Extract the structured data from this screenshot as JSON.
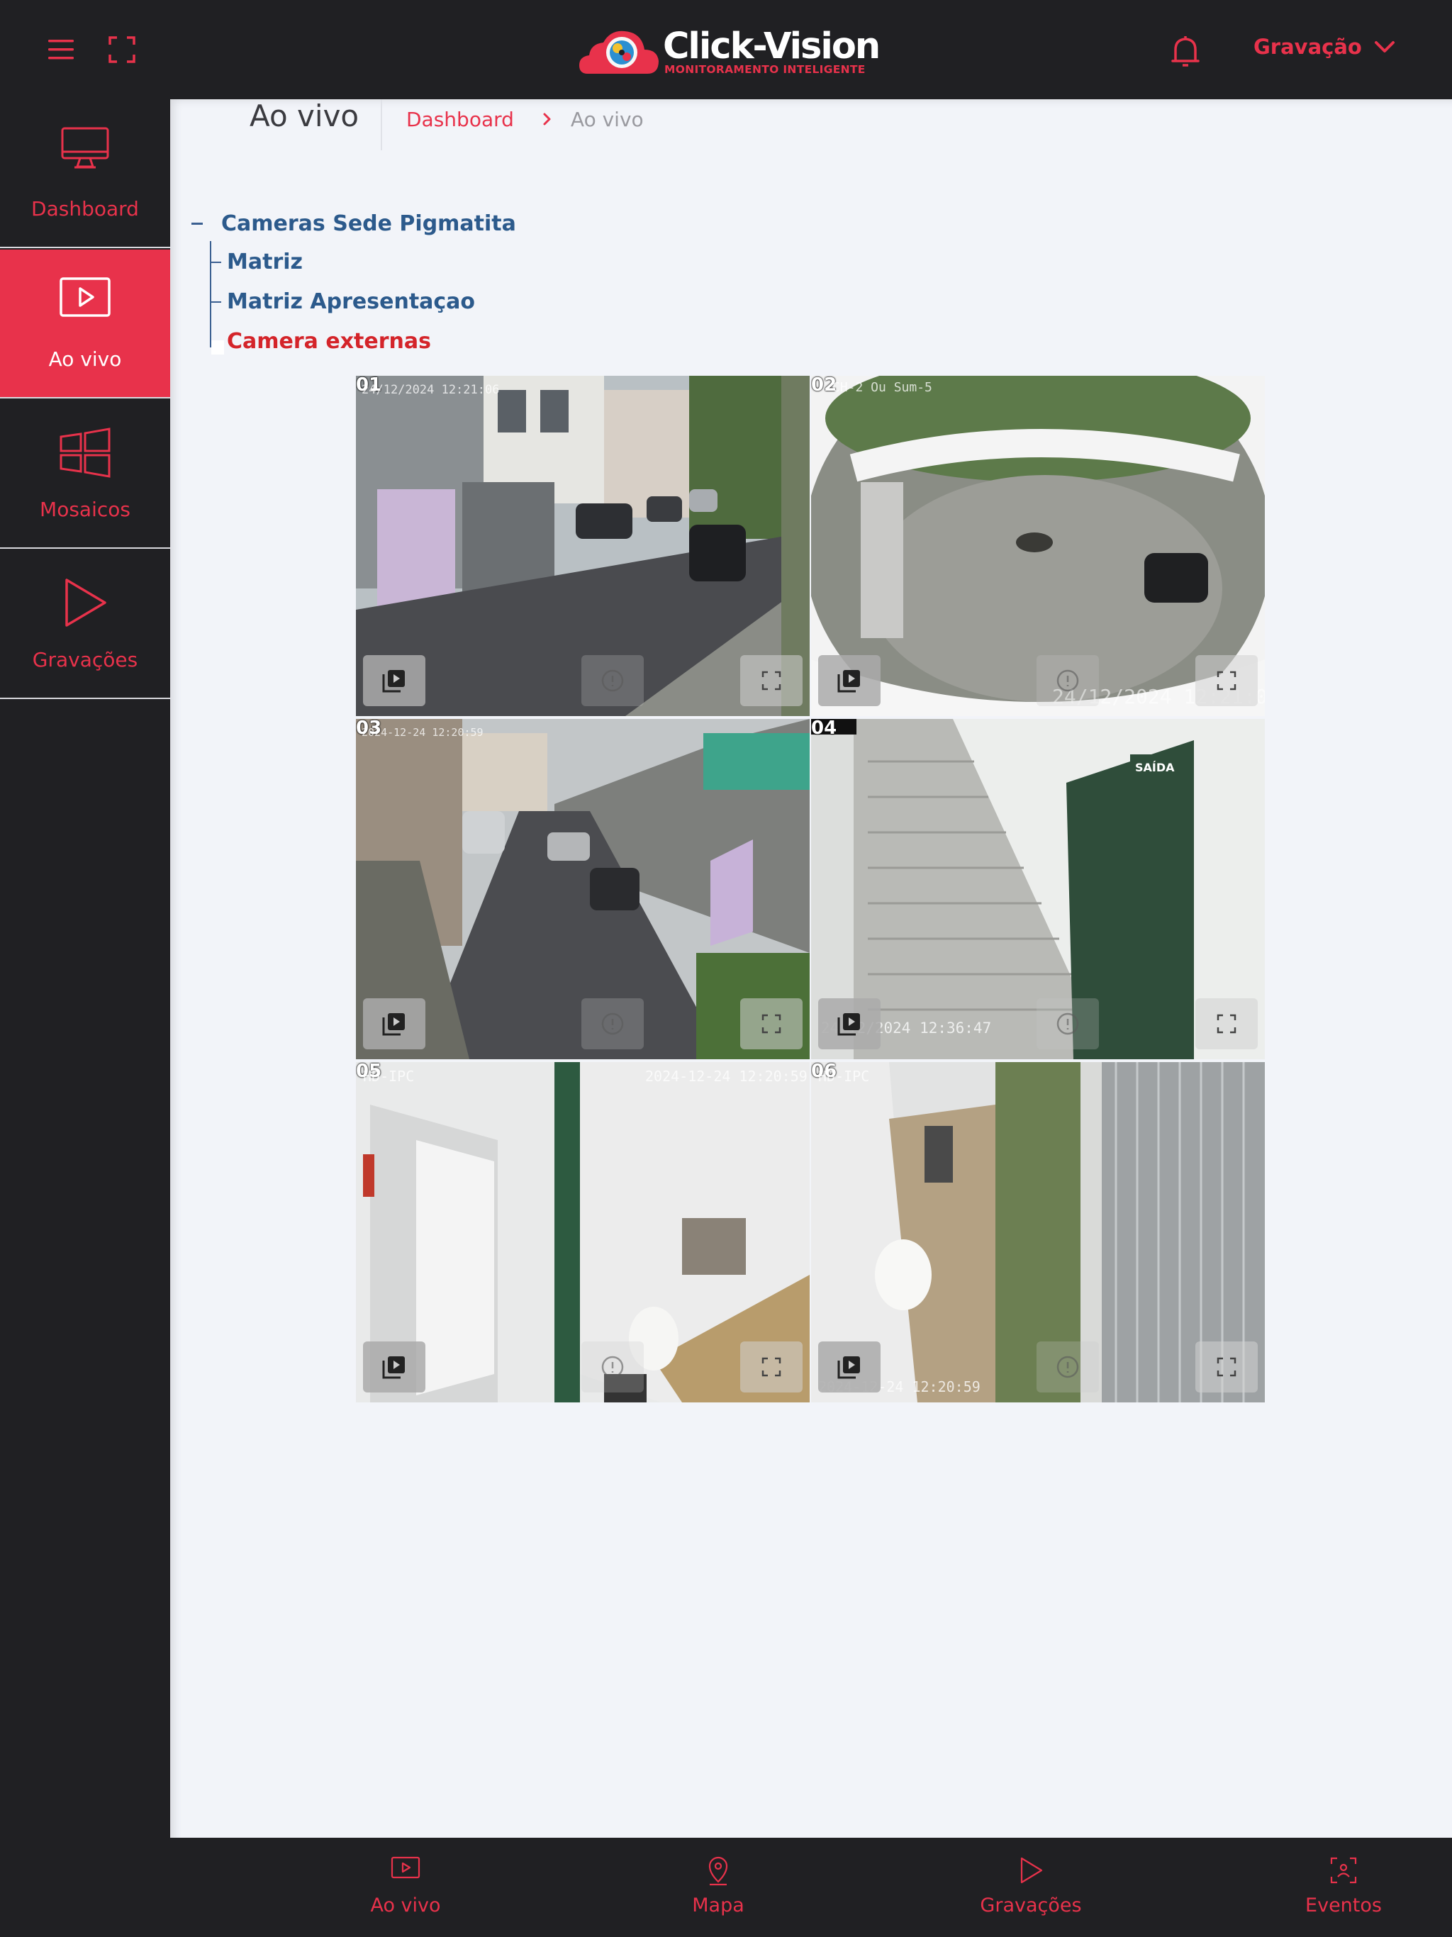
{
  "topbar": {
    "menu_icon": "hamburger-menu-icon",
    "fullscreen_icon": "fullscreen-icon",
    "logo": {
      "title": "Click-Vision",
      "tagline": "MONITORAMENTO INTELIGENTE"
    },
    "notification_icon": "bell-icon",
    "recording_menu": {
      "label": "Gravação",
      "icon": "chevron-down-icon"
    }
  },
  "sidebar": {
    "items": [
      {
        "label": "Dashboard",
        "icon": "monitor-icon",
        "active": false
      },
      {
        "label": "Ao vivo",
        "icon": "play-screen-icon",
        "active": true
      },
      {
        "label": "Mosaicos",
        "icon": "windows-grid-icon",
        "active": false
      },
      {
        "label": "Gravações",
        "icon": "play-icon",
        "active": false
      }
    ]
  },
  "page": {
    "title": "Ao vivo",
    "breadcrumb": {
      "link": "Dashboard",
      "current": "Ao vivo"
    }
  },
  "tree": {
    "root": "Cameras Sede Pigmatita",
    "children": [
      {
        "label": "Matriz",
        "selected": false
      },
      {
        "label": "Matriz Apresentaçao",
        "selected": false
      },
      {
        "label": "Camera externas",
        "selected": true
      }
    ]
  },
  "cameras": [
    {
      "number": "01",
      "overlay_top": "24/12/2024 12:21:06",
      "overlay_bottom": ""
    },
    {
      "number": "02",
      "overlay_top": "CH-2   Ou   Sum-5",
      "overlay_bottom": "24/12/2024 12:21:05"
    },
    {
      "number": "03",
      "overlay_top": "2024-12-24 12:20:59",
      "overlay_bottom": ""
    },
    {
      "number": "04",
      "overlay_top": "",
      "overlay_bottom": "24/12/2024 12:36:47"
    },
    {
      "number": "05",
      "overlay_top": "HD-IPC",
      "overlay_top_right": "2024-12-24 12:20:59",
      "overlay_bottom": ""
    },
    {
      "number": "06",
      "overlay_top": "HD-IPC",
      "overlay_bottom": "2024-12-24 12:20:59"
    }
  ],
  "bottom_nav": {
    "items": [
      {
        "label": "Ao vivo",
        "icon": "play-screen-icon"
      },
      {
        "label": "Mapa",
        "icon": "map-pin-icon"
      },
      {
        "label": "Gravações",
        "icon": "play-icon"
      },
      {
        "label": "Eventos",
        "icon": "face-scan-icon"
      }
    ]
  },
  "colors": {
    "accent": "#e8324b",
    "dark_bg": "#202023",
    "content_bg": "#f2f4f9",
    "tree_blue": "#2c5a8c",
    "tree_selected": "#d4242a"
  }
}
